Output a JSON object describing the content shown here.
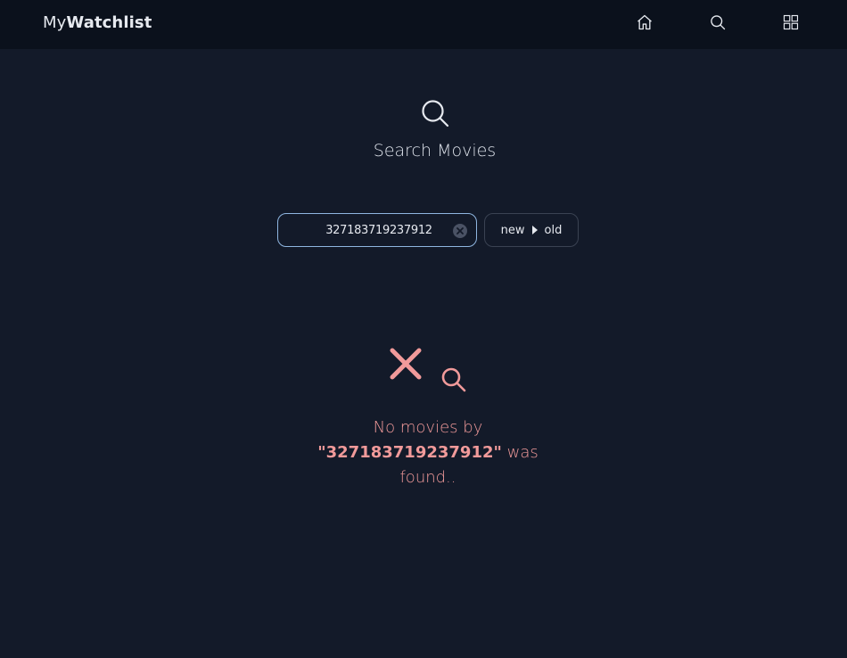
{
  "navbar": {
    "brand_light": "My",
    "brand_bold": "Watchlist"
  },
  "header": {
    "title": "Search Movies"
  },
  "search": {
    "value": "327183719237912",
    "sort_from": "new",
    "sort_to": "old"
  },
  "empty_state": {
    "line1": "No movies by",
    "open_quote": "\"",
    "query": "327183719237912",
    "close_quote": "\"",
    "was": " was",
    "line3": "found.."
  },
  "colors": {
    "background": "#131a29",
    "navbar": "#0b111c",
    "accent_error": "#f19a9a",
    "input_border": "#8fb6e0"
  }
}
